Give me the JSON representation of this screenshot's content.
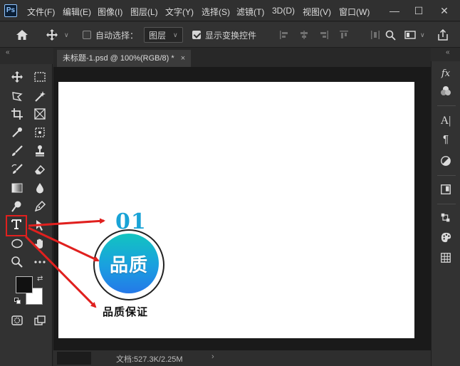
{
  "app": {
    "logo": "Ps"
  },
  "menu": [
    "文件(F)",
    "编辑(E)",
    "图像(I)",
    "图层(L)",
    "文字(Y)",
    "选择(S)",
    "滤镜(T)",
    "3D(D)",
    "视图(V)",
    "窗口(W)"
  ],
  "window_controls": {
    "minimize": "—",
    "maximize": "☐",
    "close": "✕"
  },
  "options_bar": {
    "auto_select_label": "自动选择：",
    "auto_select_checked": false,
    "target_value": "图层",
    "show_transform_label": "显示变换控件",
    "show_transform_checked": true
  },
  "document": {
    "tab_title": "未标题-1.psd @ 100%(RGB/8) *",
    "close_glyph": "×",
    "status": "文档:527.3K/2.25M",
    "status_arrow": "›"
  },
  "canvas_content": {
    "number": "01",
    "badge_text": "品质",
    "caption": "品质保证"
  },
  "right_panel": {
    "fx": "fx",
    "char": "A|",
    "para": "¶"
  },
  "colors": {
    "annotation_red": "#e0201e",
    "badge_top": "#12c4c0",
    "badge_bottom": "#2478e8",
    "number_color": "#19a3d6"
  },
  "panel_collapse": "«"
}
